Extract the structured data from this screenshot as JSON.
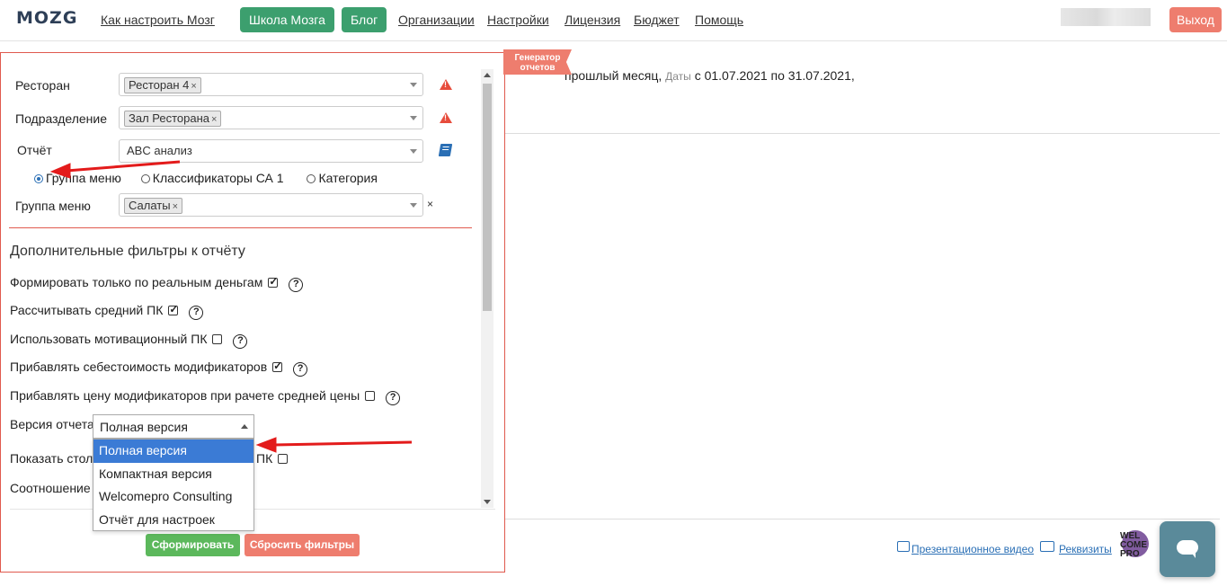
{
  "nav": {
    "logo": "MOZG",
    "how_to": "Как настроить Мозг",
    "school": "Школа Мозга",
    "blog": "Блог",
    "orgs": "Организации",
    "settings": "Настройки",
    "license": "Лицензия",
    "budget": "Бюджет",
    "help": "Помощь",
    "logout": "Выход"
  },
  "background": {
    "summary_text": "прошлый месяц,",
    "summary_dates_label": "Даты",
    "summary_dates": "с 01.07.2021 по 31.07.2021,",
    "footer_video": "Презентационное видео",
    "footer_requisites": "Реквизиты",
    "wp_logo": [
      "WEL",
      "COME",
      "PRO"
    ]
  },
  "panel": {
    "tag": "Генератор отчетов",
    "restaurant_label": "Ресторан",
    "restaurant_value": "Ресторан 4",
    "division_label": "Подразделение",
    "division_value": "Зал Ресторана",
    "report_label": "Отчёт",
    "report_value": "ABC анализ",
    "radios": [
      "Группа меню",
      "Классификаторы СА 1",
      "Категория"
    ],
    "menu_group_label": "Группа меню",
    "menu_group_value": "Салаты",
    "extra_filters_title": "Дополнительные фильтры к отчёту",
    "filters": [
      {
        "label": "Формировать только по реальным деньгам",
        "checked": true
      },
      {
        "label": "Рассчитывать средний ПК",
        "checked": true
      },
      {
        "label": "Использовать мотивационный ПК",
        "checked": false
      },
      {
        "label": "Прибавлять себестоимость модификаторов",
        "checked": true
      },
      {
        "label": "Прибавлять цену модификаторов при рачете средней цены",
        "checked": false
      }
    ],
    "version_label": "Версия отчета",
    "version_value": "Полная версия",
    "version_options": [
      "Полная версия",
      "Компактная версия",
      "Welcomepro Consulting",
      "Отчёт для настроек"
    ],
    "hidden_row1_left": "Показать стол",
    "hidden_row1_right": "ПК",
    "hidden_row2": "Соотношение",
    "submit": "Сформировать",
    "reset": "Сбросить фильтры"
  }
}
